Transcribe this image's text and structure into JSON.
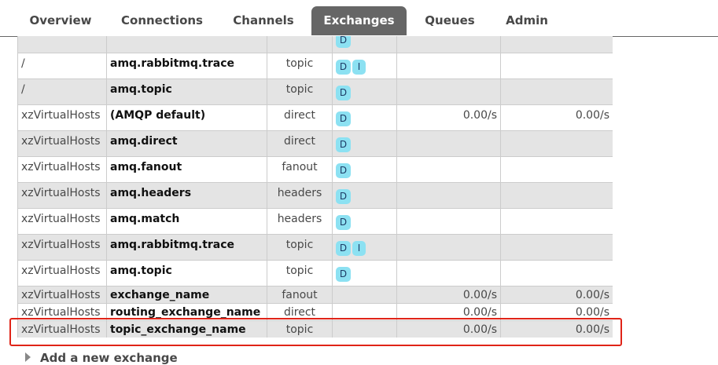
{
  "nav": {
    "tabs": [
      {
        "label": "Overview"
      },
      {
        "label": "Connections"
      },
      {
        "label": "Channels"
      },
      {
        "label": "Exchanges"
      },
      {
        "label": "Queues"
      },
      {
        "label": "Admin"
      }
    ]
  },
  "feature_labels": {
    "durable": "D",
    "internal": "I"
  },
  "rows": [
    {
      "vhost": "",
      "name": "",
      "type": "",
      "features": [
        "D"
      ],
      "rate_in": "",
      "rate_out": ""
    },
    {
      "vhost": "/",
      "name": "amq.rabbitmq.trace",
      "type": "topic",
      "features": [
        "D",
        "I"
      ],
      "rate_in": "",
      "rate_out": ""
    },
    {
      "vhost": "/",
      "name": "amq.topic",
      "type": "topic",
      "features": [
        "D"
      ],
      "rate_in": "",
      "rate_out": ""
    },
    {
      "vhost": "xzVirtualHosts",
      "name": "(AMQP default)",
      "type": "direct",
      "features": [
        "D"
      ],
      "rate_in": "0.00/s",
      "rate_out": "0.00/s"
    },
    {
      "vhost": "xzVirtualHosts",
      "name": "amq.direct",
      "type": "direct",
      "features": [
        "D"
      ],
      "rate_in": "",
      "rate_out": ""
    },
    {
      "vhost": "xzVirtualHosts",
      "name": "amq.fanout",
      "type": "fanout",
      "features": [
        "D"
      ],
      "rate_in": "",
      "rate_out": ""
    },
    {
      "vhost": "xzVirtualHosts",
      "name": "amq.headers",
      "type": "headers",
      "features": [
        "D"
      ],
      "rate_in": "",
      "rate_out": ""
    },
    {
      "vhost": "xzVirtualHosts",
      "name": "amq.match",
      "type": "headers",
      "features": [
        "D"
      ],
      "rate_in": "",
      "rate_out": ""
    },
    {
      "vhost": "xzVirtualHosts",
      "name": "amq.rabbitmq.trace",
      "type": "topic",
      "features": [
        "D",
        "I"
      ],
      "rate_in": "",
      "rate_out": ""
    },
    {
      "vhost": "xzVirtualHosts",
      "name": "amq.topic",
      "type": "topic",
      "features": [
        "D"
      ],
      "rate_in": "",
      "rate_out": ""
    },
    {
      "vhost": "xzVirtualHosts",
      "name": "exchange_name",
      "type": "fanout",
      "features": [],
      "rate_in": "0.00/s",
      "rate_out": "0.00/s"
    },
    {
      "vhost": "xzVirtualHosts",
      "name": "routing_exchange_name",
      "type": "direct",
      "features": [],
      "rate_in": "0.00/s",
      "rate_out": "0.00/s"
    },
    {
      "vhost": "xzVirtualHosts",
      "name": "topic_exchange_name",
      "type": "topic",
      "features": [],
      "rate_in": "0.00/s",
      "rate_out": "0.00/s"
    }
  ],
  "add_exchange": {
    "label": "Add a new exchange"
  },
  "colors": {
    "accent_tab": "#666666",
    "badge": "#8ce1f2",
    "highlight": "#e02418"
  }
}
